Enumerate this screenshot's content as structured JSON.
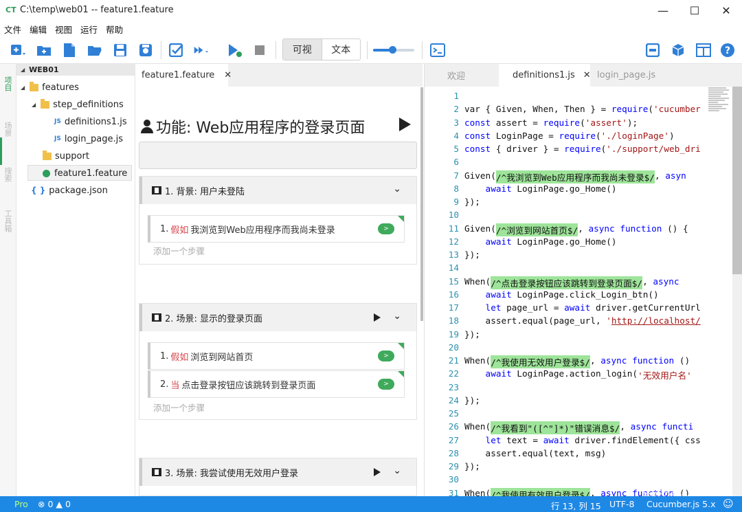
{
  "window": {
    "logo": "CT",
    "title": "C:\\temp\\web01 -- feature1.feature"
  },
  "menu": [
    "文件",
    "编辑",
    "视图",
    "运行",
    "帮助"
  ],
  "toolbar": {
    "view_mode_visual": "可视",
    "view_mode_text": "文本",
    "zoom_level": 0.45
  },
  "side_tabs": [
    "项目",
    "场景",
    "搜索",
    "工具箱"
  ],
  "explorer": {
    "header": "WEB01",
    "items": [
      {
        "label": "features",
        "type": "folder"
      },
      {
        "label": "step_definitions",
        "type": "folder"
      },
      {
        "label": "definitions1.js",
        "type": "js"
      },
      {
        "label": "login_page.js",
        "type": "js"
      },
      {
        "label": "support",
        "type": "folder"
      },
      {
        "label": "feature1.feature",
        "type": "feature"
      },
      {
        "label": "package.json",
        "type": "json"
      }
    ]
  },
  "editor_tab": {
    "label": "feature1.feature"
  },
  "feature": {
    "title": "功能: Web应用程序的登录页面",
    "scenarios": [
      {
        "title": "1. 背景: 用户未登陆",
        "steps": [
          {
            "num": "1.",
            "keyword": "假如",
            "text": "我浏览到Web应用程序而我尚未登录"
          }
        ],
        "add_step": "添加一个步骤"
      },
      {
        "title": "2. 场景: 显示的登录页面",
        "steps": [
          {
            "num": "1.",
            "keyword": "假如",
            "text": "浏览到网站首页"
          },
          {
            "num": "2.",
            "keyword": "当",
            "text": "点击登录按钮应该跳转到登录页面"
          }
        ],
        "add_step": "添加一个步骤"
      },
      {
        "title": "3. 场景: 我尝试使用无效用户登录",
        "steps": [],
        "add_step": ""
      }
    ]
  },
  "code_tabs": [
    "欢迎",
    "definitions1.js",
    "login_page.js"
  ],
  "code_lines": [
    {
      "n": "1",
      "parts": []
    },
    {
      "n": "2",
      "parts": [
        [
          "ct",
          "var { Given, When, Then } = "
        ],
        [
          "kwd",
          "require"
        ],
        [
          "ct",
          "("
        ],
        [
          "str",
          "'cucumber"
        ]
      ]
    },
    {
      "n": "3",
      "parts": [
        [
          "kwd",
          "const"
        ],
        [
          "ct",
          " assert = "
        ],
        [
          "kwd",
          "require"
        ],
        [
          "ct",
          "("
        ],
        [
          "str",
          "'assert'"
        ],
        [
          "ct",
          ");"
        ]
      ]
    },
    {
      "n": "4",
      "parts": [
        [
          "kwd",
          "const"
        ],
        [
          "ct",
          " LoginPage = "
        ],
        [
          "kwd",
          "require"
        ],
        [
          "ct",
          "("
        ],
        [
          "str",
          "'./loginPage'"
        ],
        [
          "ct",
          ")"
        ]
      ]
    },
    {
      "n": "5",
      "parts": [
        [
          "kwd",
          "const"
        ],
        [
          "ct",
          " { driver } = "
        ],
        [
          "kwd",
          "require"
        ],
        [
          "ct",
          "("
        ],
        [
          "str",
          "'./support/web_dri"
        ]
      ]
    },
    {
      "n": "6",
      "parts": []
    },
    {
      "n": "7",
      "parts": [
        [
          "ct",
          "Given("
        ],
        [
          "rx",
          "/^我浏览到Web应用程序而我尚未登录$/"
        ],
        [
          "ct",
          ", "
        ],
        [
          "kwd",
          "asyn"
        ]
      ]
    },
    {
      "n": "8",
      "parts": [
        [
          "kwd",
          "    await"
        ],
        [
          "ct",
          " LoginPage.go_Home()"
        ]
      ]
    },
    {
      "n": "9",
      "parts": [
        [
          "ct",
          "});"
        ]
      ]
    },
    {
      "n": "10",
      "parts": []
    },
    {
      "n": "11",
      "parts": [
        [
          "ct",
          "Given("
        ],
        [
          "rx",
          "/^浏览到网站首页$/"
        ],
        [
          "ct",
          ", "
        ],
        [
          "kwd",
          "async function"
        ],
        [
          "ct",
          " () {"
        ]
      ]
    },
    {
      "n": "12",
      "parts": [
        [
          "kwd",
          "    await"
        ],
        [
          "ct",
          " LoginPage.go_Home()"
        ]
      ]
    },
    {
      "n": "13",
      "parts": [
        [
          "ct",
          "});"
        ]
      ]
    },
    {
      "n": "14",
      "parts": []
    },
    {
      "n": "15",
      "parts": [
        [
          "ct",
          "When("
        ],
        [
          "rx",
          "/^点击登录按钮应该跳转到登录页面$/"
        ],
        [
          "ct",
          ", "
        ],
        [
          "kwd",
          "async"
        ]
      ]
    },
    {
      "n": "16",
      "parts": [
        [
          "kwd",
          "    await"
        ],
        [
          "ct",
          " LoginPage.click_Login_btn()"
        ]
      ]
    },
    {
      "n": "17",
      "parts": [
        [
          "kwd",
          "    let"
        ],
        [
          "ct",
          " page_url = "
        ],
        [
          "kwd",
          "await"
        ],
        [
          "ct",
          " driver.getCurrentUrl"
        ]
      ]
    },
    {
      "n": "18",
      "parts": [
        [
          "ct",
          "    assert.equal(page_url, "
        ],
        [
          "str",
          "'"
        ],
        [
          "url",
          "http://localhost/"
        ]
      ]
    },
    {
      "n": "19",
      "parts": [
        [
          "ct",
          "});"
        ]
      ]
    },
    {
      "n": "20",
      "parts": []
    },
    {
      "n": "21",
      "parts": [
        [
          "ct",
          "When("
        ],
        [
          "rx",
          "/^我使用无效用户登录$/"
        ],
        [
          "ct",
          ", "
        ],
        [
          "kwd",
          "async function"
        ],
        [
          "ct",
          " ()"
        ]
      ]
    },
    {
      "n": "22",
      "parts": [
        [
          "kwd",
          "    await"
        ],
        [
          "ct",
          " LoginPage.action_login("
        ],
        [
          "str",
          "'无效用户名'"
        ]
      ]
    },
    {
      "n": "23",
      "parts": []
    },
    {
      "n": "24",
      "parts": [
        [
          "ct",
          "});"
        ]
      ]
    },
    {
      "n": "25",
      "parts": []
    },
    {
      "n": "26",
      "parts": [
        [
          "ct",
          "When("
        ],
        [
          "rx",
          "/^我看到\"([^\"]*)\"错误消息$/"
        ],
        [
          "ct",
          ", "
        ],
        [
          "kwd",
          "async functi"
        ]
      ]
    },
    {
      "n": "27",
      "parts": [
        [
          "kwd",
          "    let"
        ],
        [
          "ct",
          " text = "
        ],
        [
          "kwd",
          "await"
        ],
        [
          "ct",
          " driver.findElement({ css"
        ]
      ]
    },
    {
      "n": "28",
      "parts": [
        [
          "ct",
          "    assert.equal(text, msg)"
        ]
      ]
    },
    {
      "n": "29",
      "parts": [
        [
          "ct",
          "});"
        ]
      ]
    },
    {
      "n": "30",
      "parts": []
    },
    {
      "n": "31",
      "parts": [
        [
          "ct",
          "When("
        ],
        [
          "rx",
          "/^我使用有效用户登录$/"
        ],
        [
          "ct",
          ", "
        ],
        [
          "kwd",
          "async function"
        ],
        [
          "ct",
          " ()"
        ]
      ]
    }
  ],
  "status": {
    "edition": "Pro",
    "errors": "0",
    "warnings": "0",
    "position": "行 13, 列 15",
    "encoding": "UTF-8",
    "runtime": "Cucumber.js 5.x",
    "watermark": "testerhome.com"
  }
}
